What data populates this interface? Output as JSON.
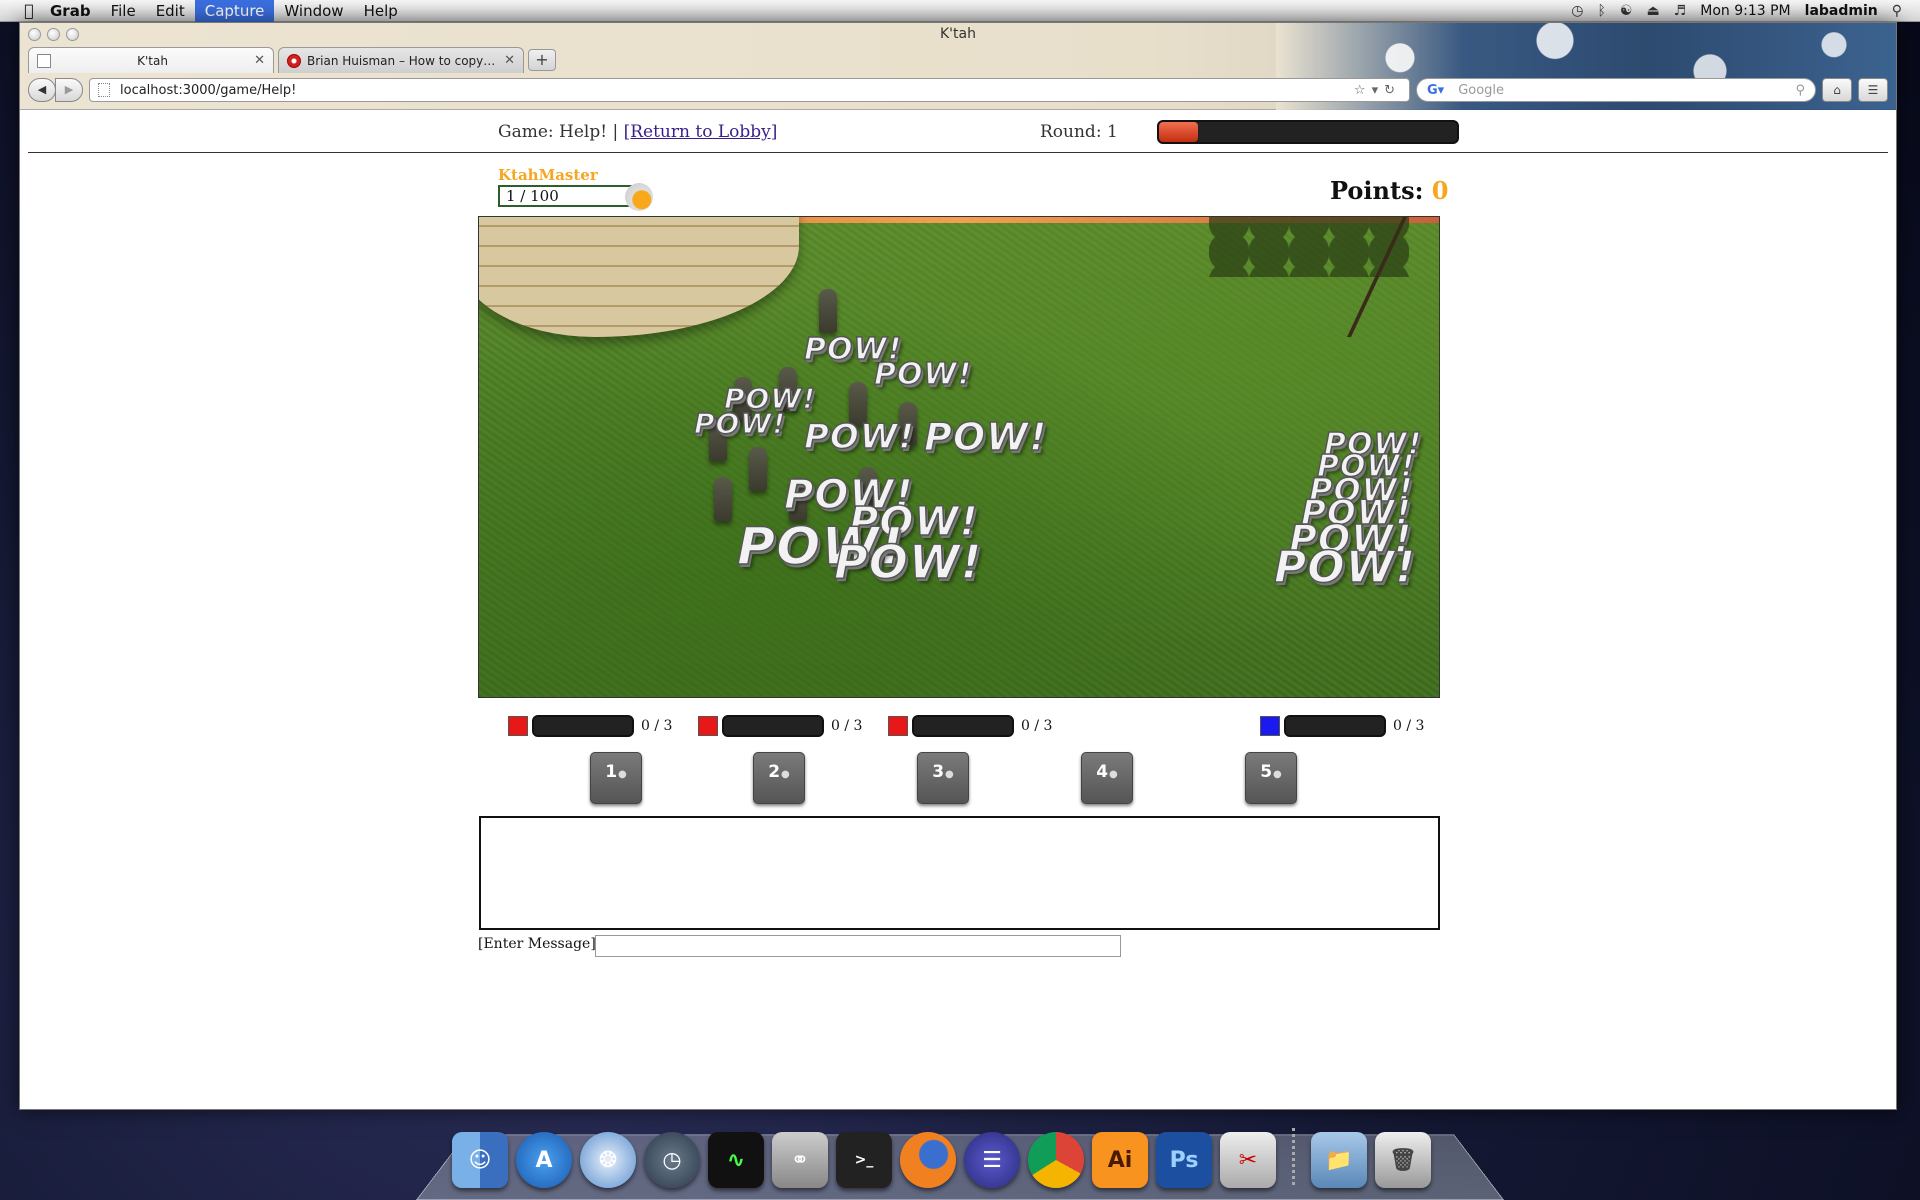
{
  "menubar": {
    "app": "Grab",
    "menus": [
      "File",
      "Edit",
      "Capture",
      "Window",
      "Help"
    ],
    "active_menu": "Capture",
    "clock": "Mon 9:13 PM",
    "user": "labadmin"
  },
  "browser": {
    "window_title": "K'tah",
    "tabs": [
      {
        "label": "K'tah",
        "active": true
      },
      {
        "label": "Brian Huisman – How to copy a...",
        "active": false
      }
    ],
    "new_tab": "+",
    "url": "localhost:3000/game/Help!",
    "search_placeholder": "Google"
  },
  "game": {
    "game_label": "Game: Help! | ",
    "lobby_link": "[Return to Lobby]",
    "round_label": "Round: 1",
    "round_progress": 0.13,
    "player_name": "KtahMaster",
    "health": "1 / 100",
    "points_label": "Points: ",
    "points_value": "0",
    "effect_text": "POW!",
    "players": [
      {
        "color": "#e81818",
        "count": "0 / 3"
      },
      {
        "color": "#e81818",
        "count": "0 / 3"
      },
      {
        "color": "#e81818",
        "count": "0 / 3"
      },
      {
        "color": "#1a1aee",
        "count": "0 / 3"
      }
    ],
    "abilities": [
      "1",
      "2",
      "3",
      "4",
      "5"
    ],
    "chat_label": "[Enter Message]",
    "chat_value": ""
  }
}
